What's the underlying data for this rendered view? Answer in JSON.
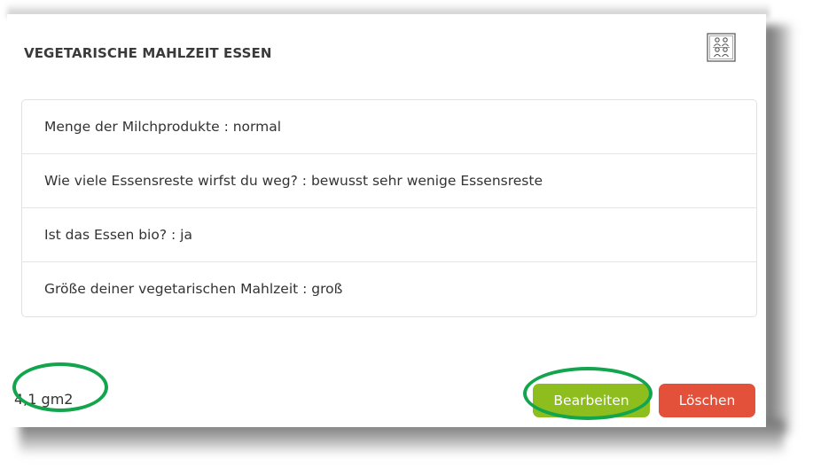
{
  "dialog": {
    "title": "VEGETARISCHE MAHLZEIT ESSEN",
    "header_icon": "group-people-icon"
  },
  "answers": [
    {
      "text": "Menge der Milchprodukte : normal"
    },
    {
      "text": "Wie viele Essensreste wirfst du weg? : bewusst sehr wenige Essensreste"
    },
    {
      "text": "Ist das Essen bio? : ja"
    },
    {
      "text": "Größe deiner vegetarischen Mahlzeit : groß"
    }
  ],
  "footprint": {
    "value": "4,1 gm2"
  },
  "actions": {
    "edit_label": "Bearbeiten",
    "delete_label": "Löschen"
  },
  "colors": {
    "edit_button": "#8ebd1e",
    "delete_button": "#e4513a",
    "annotation_ring": "#12a54e"
  }
}
